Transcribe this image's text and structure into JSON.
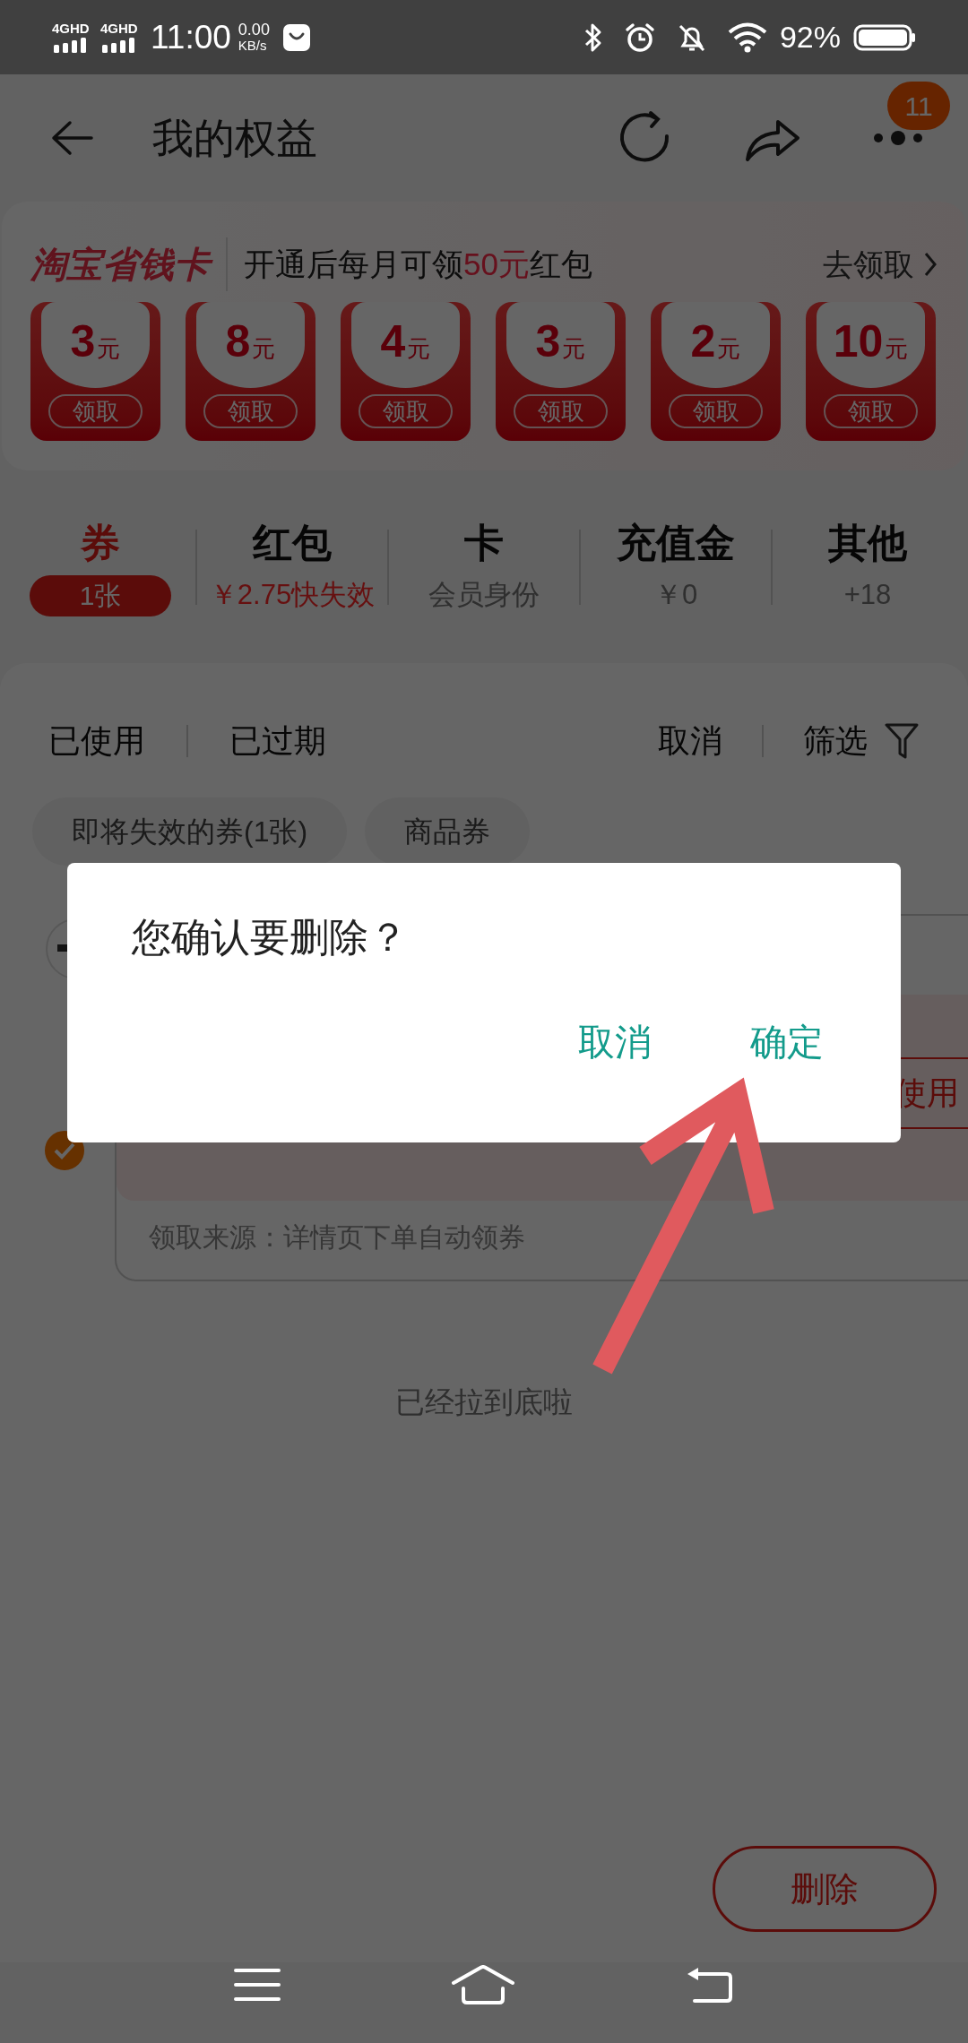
{
  "status_bar": {
    "networks": [
      "4GHD",
      "4GHD"
    ],
    "time": "11:00",
    "speed": "0.00",
    "speed_unit": "KB/s",
    "battery": "92%"
  },
  "header": {
    "title": "我的权益",
    "badge": "11"
  },
  "savings_card": {
    "brand": "淘宝省钱卡",
    "text_before": "开通后每月可领",
    "highlight": "50元",
    "text_after": "红包",
    "action": "去领取",
    "coupons": [
      {
        "amount": "3",
        "unit": "元",
        "button": "领取"
      },
      {
        "amount": "8",
        "unit": "元",
        "button": "领取"
      },
      {
        "amount": "4",
        "unit": "元",
        "button": "领取"
      },
      {
        "amount": "3",
        "unit": "元",
        "button": "领取"
      },
      {
        "amount": "2",
        "unit": "元",
        "button": "领取"
      },
      {
        "amount": "10",
        "unit": "元",
        "button": "领取"
      }
    ]
  },
  "tabs": [
    {
      "label": "券",
      "sub": "1张",
      "selected": true,
      "alert": false
    },
    {
      "label": "红包",
      "sub": "￥2.75快失效",
      "selected": false,
      "alert": true
    },
    {
      "label": "卡",
      "sub": "会员身份",
      "selected": false,
      "alert": false
    },
    {
      "label": "充值金",
      "sub": "￥0",
      "selected": false,
      "alert": false
    },
    {
      "label": "其他",
      "sub": "+18",
      "selected": false,
      "alert": false
    }
  ],
  "filters": {
    "left": [
      "已使用",
      "已过期"
    ],
    "cancel": "取消",
    "filter": "筛选"
  },
  "chips": [
    "即将失效的券(1张)",
    "商品券"
  ],
  "coupon": {
    "checked": true,
    "use_button": "使用",
    "source": "领取来源：详情页下单自动领券"
  },
  "end_text": "已经拉到底啦",
  "delete_button": "删除",
  "dialog": {
    "message": "您确认要删除？",
    "buttons": [
      "取消",
      "确定"
    ]
  }
}
